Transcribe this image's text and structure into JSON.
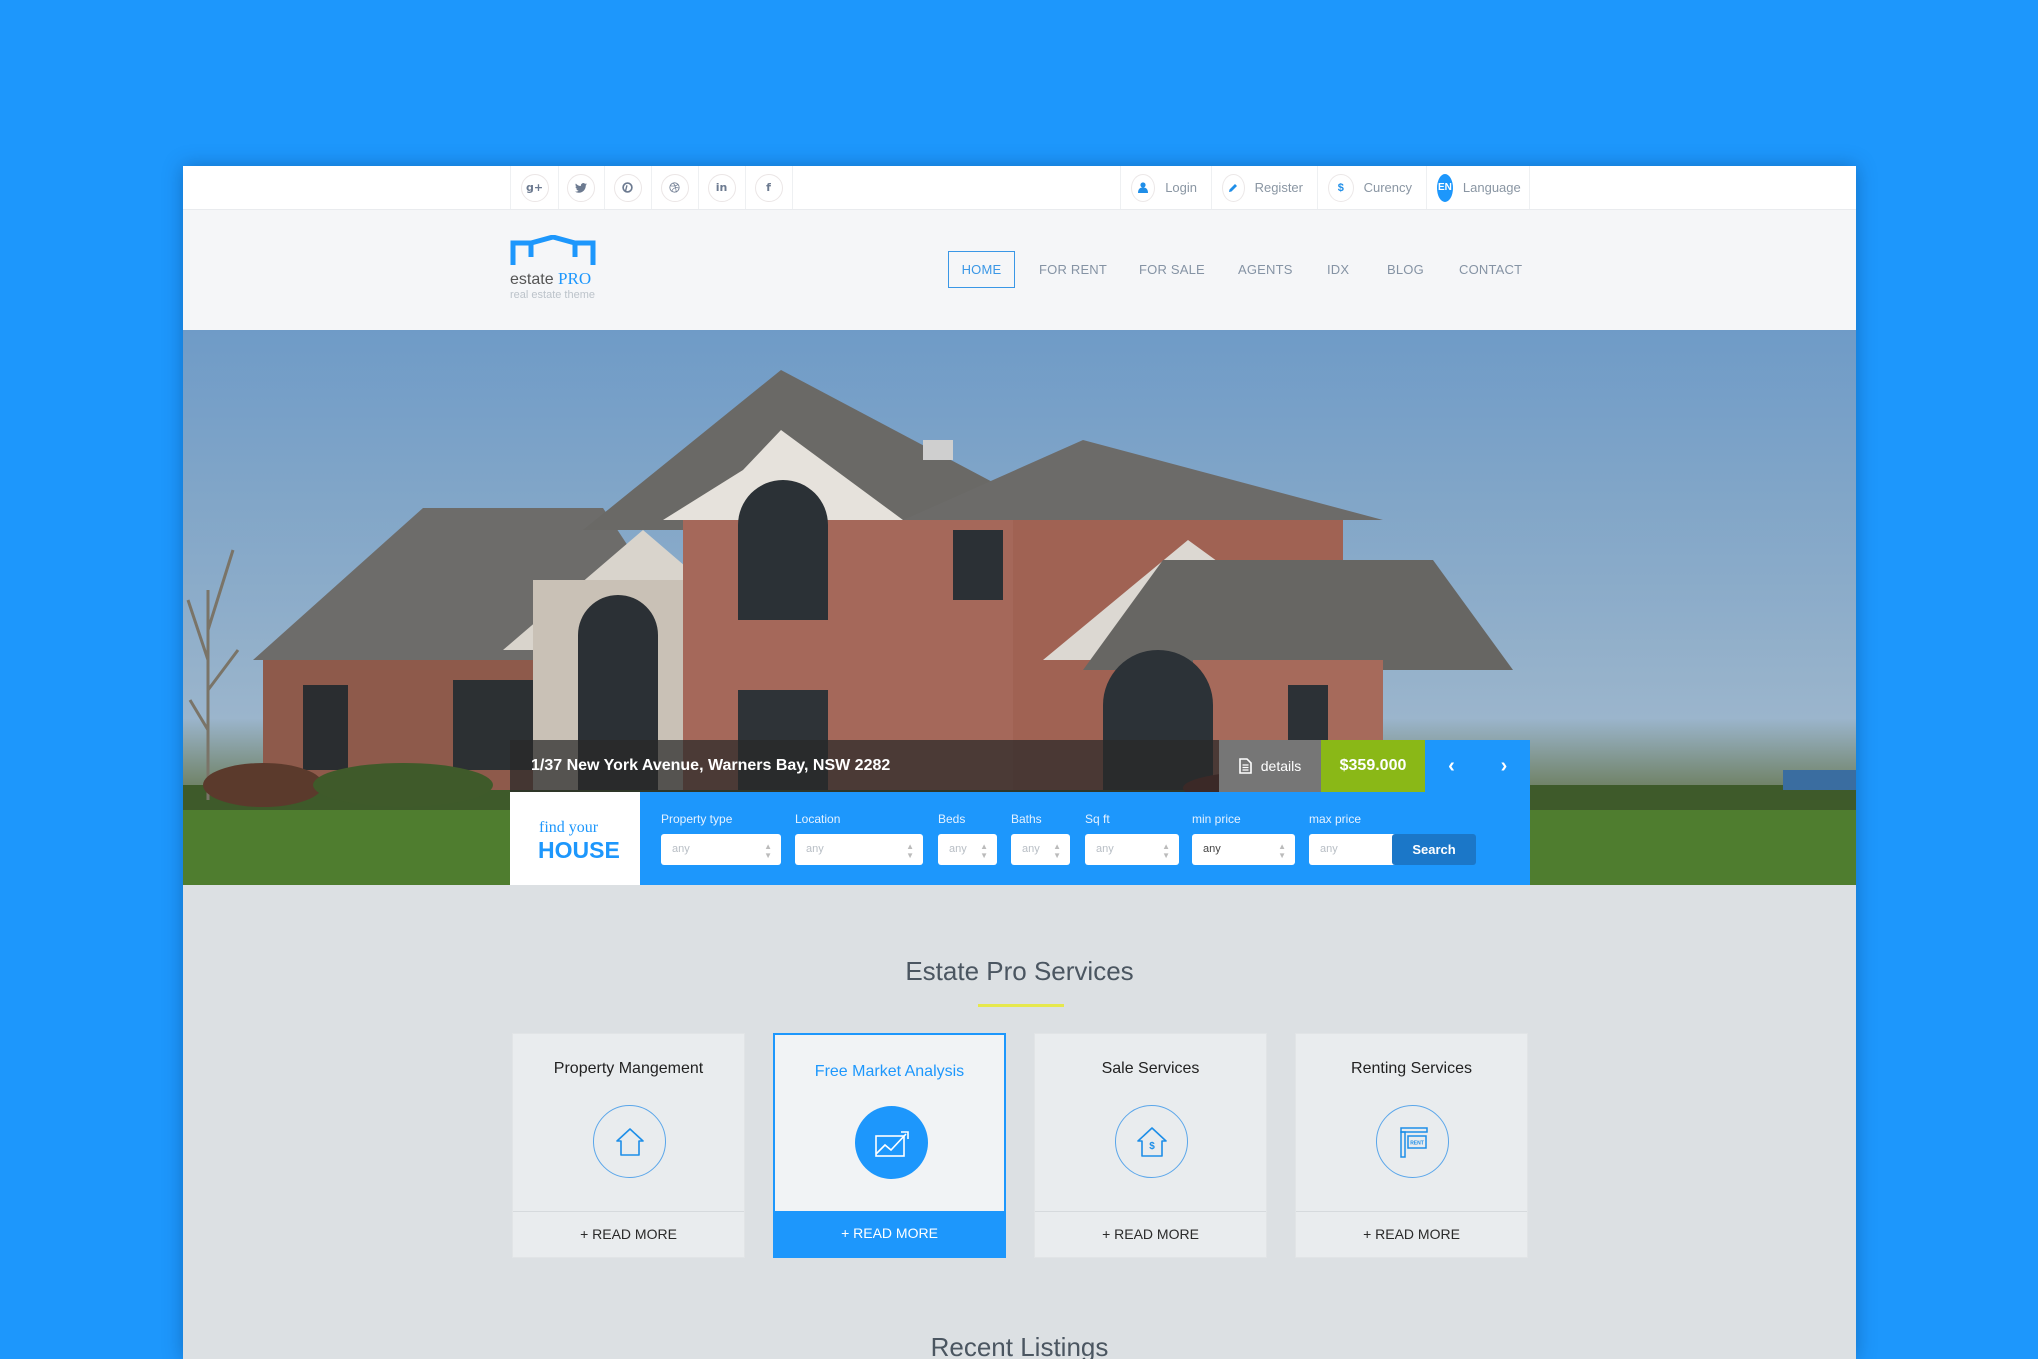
{
  "topbar": {
    "social": [
      {
        "name": "google-plus-icon",
        "glyph": "g+"
      },
      {
        "name": "twitter-icon",
        "glyph": "t"
      },
      {
        "name": "pinterest-icon",
        "glyph": "p"
      },
      {
        "name": "dribbble-icon",
        "glyph": "◎"
      },
      {
        "name": "linkedin-icon",
        "glyph": "in"
      },
      {
        "name": "facebook-icon",
        "glyph": "f"
      }
    ],
    "account": {
      "login": "Login",
      "register": "Register",
      "currency": "Curency",
      "currency_glyph": "$",
      "language_code": "EN",
      "language": "Language"
    }
  },
  "logo": {
    "brand": "estate",
    "brand_accent": "PRO",
    "tagline": "real estate theme"
  },
  "nav": {
    "items": [
      "HOME",
      "FOR RENT",
      "FOR SALE",
      "AGENTS",
      "IDX",
      "BLOG",
      "CONTACT"
    ],
    "active": "HOME"
  },
  "hero": {
    "address": "1/37 New York Avenue, Warners Bay, NSW 2282",
    "details_label": "details",
    "price": "$359.000",
    "prev_glyph": "‹",
    "next_glyph": "›"
  },
  "search": {
    "find_line1": "find your",
    "find_line2": "HOUSE",
    "fields": [
      {
        "label": "Property type",
        "value": "any"
      },
      {
        "label": "Location",
        "value": "any"
      },
      {
        "label": "Beds",
        "value": "any"
      },
      {
        "label": "Baths",
        "value": "any"
      },
      {
        "label": "Sq ft",
        "value": "any"
      },
      {
        "label": "min price",
        "value": "any"
      },
      {
        "label": "max price",
        "value": "any"
      }
    ],
    "button": "Search"
  },
  "services": {
    "title": "Estate Pro Services",
    "cards": [
      {
        "title": "Property Mangement",
        "icon": "house-icon",
        "cta": "+ READ MORE"
      },
      {
        "title": "Free Market Analysis",
        "icon": "chart-icon",
        "cta": "+ READ MORE"
      },
      {
        "title": "Sale Services",
        "icon": "house-dollar-icon",
        "cta": "+ READ MORE"
      },
      {
        "title": "Renting Services",
        "icon": "rent-sign-icon",
        "cta": "+ READ MORE"
      }
    ],
    "rent_sign_text": "RENT",
    "dollar_glyph": "$"
  },
  "recent": {
    "title": "Recent Listings"
  },
  "colors": {
    "background": "#1d97fc",
    "accent": "#1d97fc",
    "price": "#8ab817",
    "search_button": "#1b77c8",
    "underline": "#e6e84c"
  }
}
